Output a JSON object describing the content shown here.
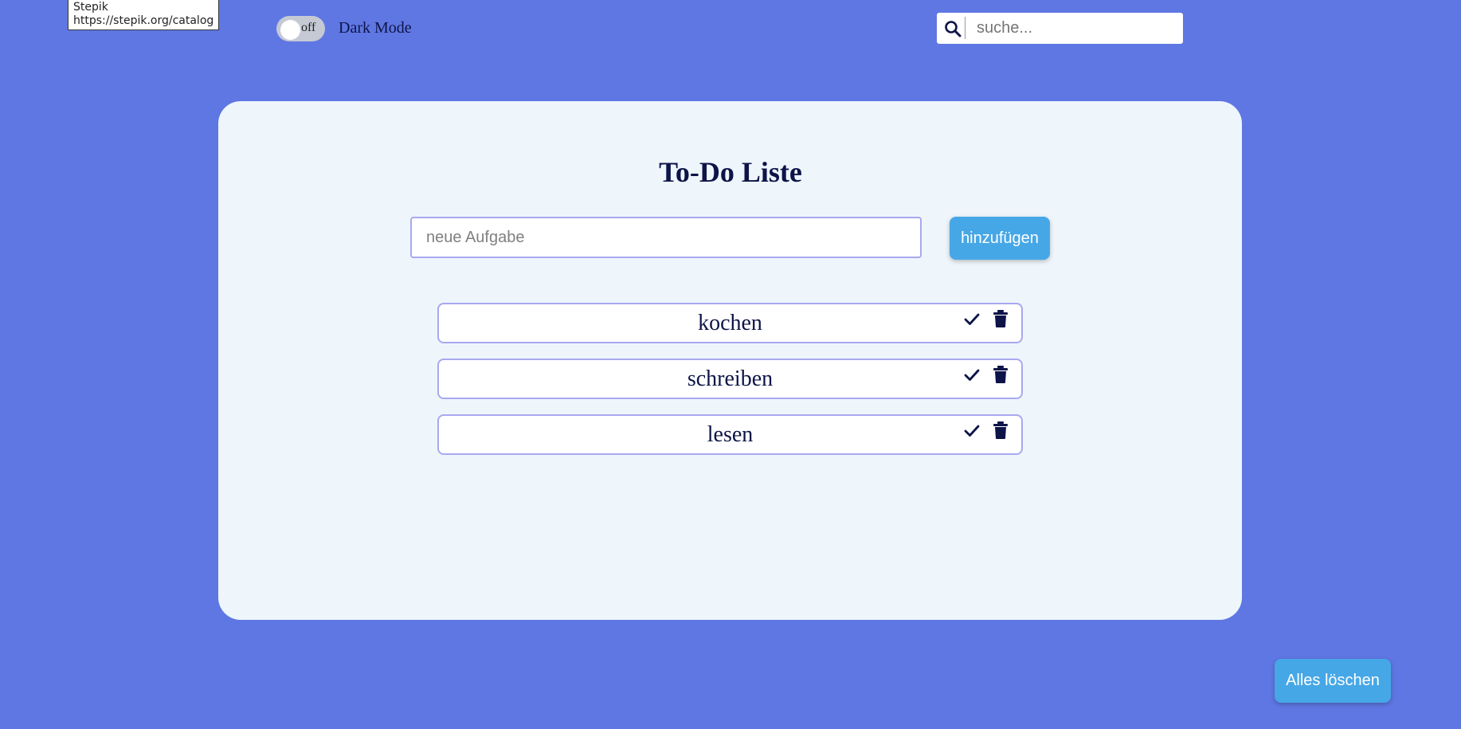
{
  "tooltip": {
    "title": "Stepik",
    "url": "https://stepik.org/catalog"
  },
  "header": {
    "toggle_state": "off",
    "toggle_label": "Dark Mode",
    "search_placeholder": "suche..."
  },
  "main": {
    "title": "To-Do Liste",
    "task_placeholder": "neue Aufgabe",
    "add_label": "hinzufügen",
    "items": [
      {
        "text": "kochen",
        "check_icon": "check-icon",
        "delete_icon": "trash-icon"
      },
      {
        "text": "schreiben",
        "check_icon": "check-icon",
        "delete_icon": "trash-icon"
      },
      {
        "text": "lesen",
        "check_icon": "check-icon",
        "delete_icon": "trash-icon"
      }
    ]
  },
  "footer": {
    "clear_label": "Alles löschen"
  },
  "colors": {
    "background": "#5f77e3",
    "card": "#eef6fc",
    "button": "#46a7e6",
    "text": "#0d1448",
    "border": "#a8a8f0"
  }
}
